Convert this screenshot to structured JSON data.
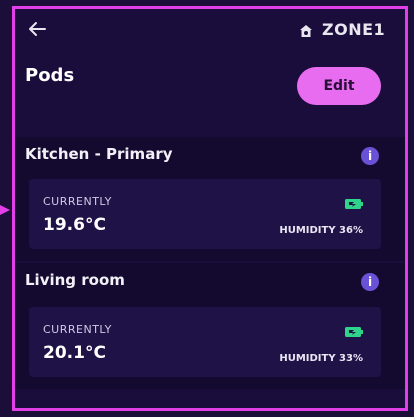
{
  "header": {
    "zone": "ZONE1"
  },
  "page": {
    "title": "Pods",
    "edit_label": "Edit"
  },
  "pods": [
    {
      "name": "Kitchen - Primary",
      "currently_label": "CURRENTLY",
      "temperature": "19.6°C",
      "humidity": "HUMIDITY 36%"
    },
    {
      "name": "Living room",
      "currently_label": "CURRENTLY",
      "temperature": "20.1°C",
      "humidity": "HUMIDITY 33%"
    }
  ],
  "icons": {
    "back": "back-arrow-icon",
    "home": "home-icon",
    "info": "info-icon",
    "battery": "battery-icon"
  },
  "colors": {
    "accent": "#e86cf0",
    "frame": "#e33fe8",
    "info": "#6a52d6",
    "battery": "#2fd38a"
  }
}
